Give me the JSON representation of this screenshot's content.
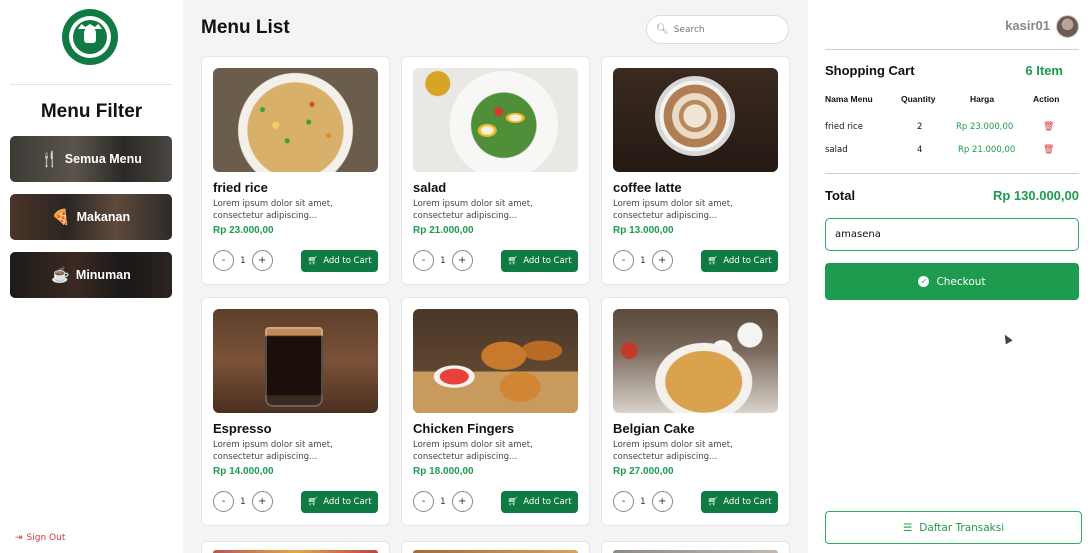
{
  "sidebar": {
    "filter_title": "Menu Filter",
    "buttons": [
      {
        "label": "Semua Menu",
        "icon": "utensils-icon"
      },
      {
        "label": "Makanan",
        "icon": "pizza-icon"
      },
      {
        "label": "Minuman",
        "icon": "coffee-cup-icon"
      }
    ],
    "signout_label": "Sign Out"
  },
  "main": {
    "title": "Menu List",
    "search_placeholder": "Search",
    "add_to_cart_label": "Add to Cart",
    "products": [
      {
        "name": "fried rice",
        "desc": "Lorem ipsum dolor sit amet, consectetur adipiscing...",
        "price": "Rp 23.000,00",
        "qty": "1",
        "image": "fried-rice"
      },
      {
        "name": "salad",
        "desc": "Lorem ipsum dolor sit amet, consectetur adipiscing...",
        "price": "Rp 21.000,00",
        "qty": "1",
        "image": "salad"
      },
      {
        "name": "coffee latte",
        "desc": "Lorem ipsum dolor sit amet, consectetur adipiscing...",
        "price": "Rp 13.000,00",
        "qty": "1",
        "image": "coffee-latte"
      },
      {
        "name": "Espresso",
        "desc": "Lorem ipsum dolor sit amet, consectetur adipiscing...",
        "price": "Rp 14.000,00",
        "qty": "1",
        "image": "espresso"
      },
      {
        "name": "Chicken Fingers",
        "desc": "Lorem ipsum dolor sit amet, consectetur adipiscing...",
        "price": "Rp 18.000,00",
        "qty": "1",
        "image": "chicken-fingers"
      },
      {
        "name": "Belgian Cake",
        "desc": "Lorem ipsum dolor sit amet, consectetur adipiscing...",
        "price": "Rp 27.000,00",
        "qty": "1",
        "image": "belgian-cake"
      }
    ]
  },
  "cart": {
    "username": "kasir01",
    "title": "Shopping Cart",
    "count": "6 Item",
    "columns": [
      "Nama Menu",
      "Quantity",
      "Harga",
      "Action"
    ],
    "rows": [
      {
        "name": "fried rice",
        "qty": "2",
        "price": "Rp 23.000,00"
      },
      {
        "name": "salad",
        "qty": "4",
        "price": "Rp 21.000,00"
      }
    ],
    "total_label": "Total",
    "total_value": "Rp 130.000,00",
    "customer_name": "amasena",
    "checkout_label": "Checkout",
    "transactions_label": "Daftar Transaksi"
  },
  "colors": {
    "brand_green": "#0f7a43",
    "accent_green": "#1e9b4e",
    "danger_red": "#d93a3a"
  }
}
